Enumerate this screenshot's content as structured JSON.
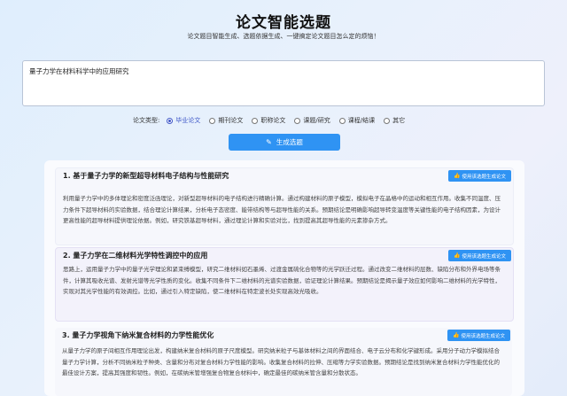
{
  "header": {
    "title": "论文智能选题",
    "subtitle": "论文题目智能生成、选题依据生成、一键搞定论文题目怎么定的烦恼！"
  },
  "topic_input": {
    "value": "量子力学在材料科学中的应用研究"
  },
  "paper_type": {
    "label": "论文类型:",
    "options": [
      {
        "label": "毕业论文",
        "selected": true
      },
      {
        "label": "期刊论文",
        "selected": false
      },
      {
        "label": "职称论文",
        "selected": false
      },
      {
        "label": "课题/研究",
        "selected": false
      },
      {
        "label": "课程/结课",
        "selected": false
      },
      {
        "label": "其它",
        "selected": false
      }
    ]
  },
  "generate_button": {
    "label": "生成选题"
  },
  "results": [
    {
      "title": "1. 基于量子力学的新型超导材料电子结构与性能研究",
      "button": "使用该选题生成论文",
      "body": "利用量子力学中的多体理论和密度泛函理论，对新型超导材料的电子结构进行精确计算。通过构建材料的原子模型，模拟电子在晶格中的运动和相互作用。收集不同温度、压力条件下超导材料的实验数据，结合理论计算结果，分析电子态密度、能带结构等与超导性能的关系。预期结论是明确影响超导转变温度等关键性能的电子结构因素，为设计更高性能的超导材料提供理论依据。例如，研究铁基超导材料，通过理论计算和实验对比，找到提高其超导性能的元素掺杂方式。"
    },
    {
      "title": "2. 量子力学在二维材料光学特性调控中的应用",
      "button": "使用该选题生成论文",
      "body": "思路上，运用量子力学中的量子光学理论和紧束缚模型，研究二维材料如石墨烯、过渡金属硫化合物等的光学跃迁过程。通过改变二维材料的层数、缺陷分布和外界电场等条件，计算其吸收光谱、发射光谱等光学性质的变化。收集不同条件下二维材料的光谱实验数据，验证理论计算结果。预期结论是揭示量子效应如何影响二维材料的光学特性，实现对其光学性能的有效调控。比如，通过引入特定缺陷，使二维材料在特定波长处实现高效光吸收。"
    },
    {
      "title": "3. 量子力学视角下纳米复合材料的力学性能优化",
      "button": "使用该选题生成论文",
      "body": "从量子力学的原子间相互作用理论出发，构建纳米复合材料的原子尺度模型。研究纳米粒子与基体材料之间的界面结合、电子云分布和化学键形成。采用分子动力学模拟结合量子力学计算，分析不同纳米粒子种类、含量和分布对复合材料力学性能的影响。收集复合材料的拉伸、压缩等力学实验数据。预期结论是找到纳米复合材料力学性能优化的最佳设计方案，提高其强度和韧性。例如，在碳纳米管增强复合物复合材料中，确定最佳的碳纳米管含量和分散状态。"
    }
  ]
}
